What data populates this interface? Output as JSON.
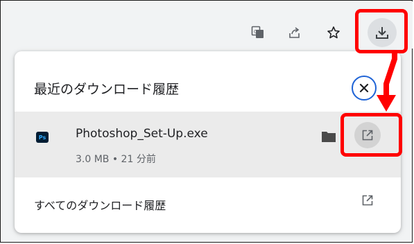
{
  "toolbar": {
    "icons": [
      "translate-icon",
      "share-icon",
      "star-icon",
      "download-icon"
    ]
  },
  "downloads_panel": {
    "title": "最近のダウンロード履歴",
    "close_icon": "close-icon",
    "item": {
      "app_badge": "Ps",
      "file_name": "Photoshop_Set-Up.exe",
      "meta": "3.0 MB • 21 分前",
      "icons": [
        "photoshop-icon",
        "folder-icon",
        "open-external-icon"
      ]
    },
    "all_history_label": "すべてのダウンロード履歴"
  },
  "annotation": {
    "highlight_color": "#ff0000",
    "accent_color": "#1e63d6"
  }
}
